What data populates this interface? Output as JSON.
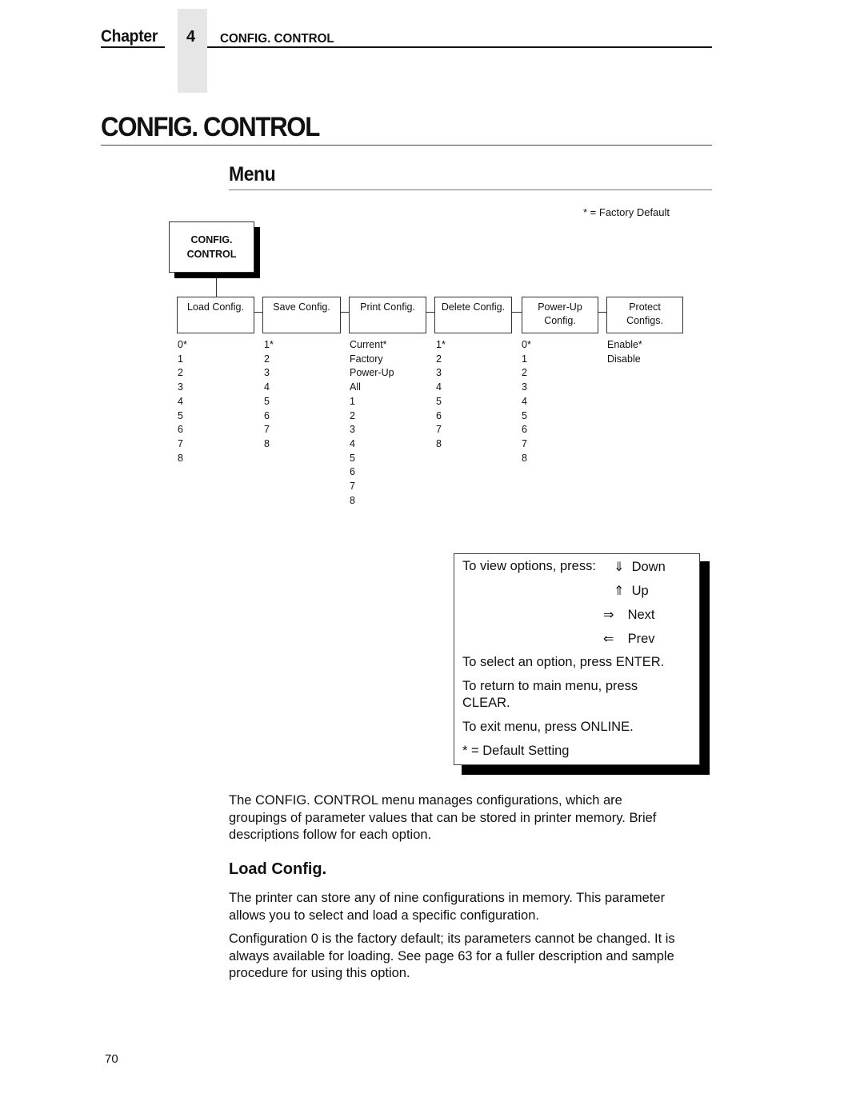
{
  "header": {
    "chapter_word": "Chapter",
    "chapter_number": "4",
    "chapter_title": "CONFIG. CONTROL"
  },
  "page_title": "CONFIG. CONTROL",
  "menu_section": {
    "heading": "Menu",
    "factory_default_note": "* = Factory Default"
  },
  "diagram": {
    "root": {
      "line1": "CONFIG.",
      "line2": "CONTROL"
    },
    "submenus": [
      {
        "label_line1": "Load Config.",
        "label_line2": "",
        "options": [
          "0*",
          "1",
          "2",
          "3",
          "4",
          "5",
          "6",
          "7",
          "8"
        ]
      },
      {
        "label_line1": "Save Config.",
        "label_line2": "",
        "options": [
          "1*",
          "2",
          "3",
          "4",
          "5",
          "6",
          "7",
          "8"
        ]
      },
      {
        "label_line1": "Print Config.",
        "label_line2": "",
        "options": [
          "Current*",
          "Factory",
          "Power-Up",
          "All",
          "1",
          "2",
          "3",
          "4",
          "5",
          "6",
          "7",
          "8"
        ]
      },
      {
        "label_line1": "Delete Config.",
        "label_line2": "",
        "options": [
          "1*",
          "2",
          "3",
          "4",
          "5",
          "6",
          "7",
          "8"
        ]
      },
      {
        "label_line1": "Power-Up",
        "label_line2": "Config.",
        "options": [
          "0*",
          "1",
          "2",
          "3",
          "4",
          "5",
          "6",
          "7",
          "8"
        ]
      },
      {
        "label_line1": "Protect",
        "label_line2": "Configs.",
        "options": [
          "Enable*",
          "Disable"
        ]
      }
    ]
  },
  "help_box": {
    "view_prefix": "To view options, press:",
    "nav": [
      {
        "icon": "double-arrow-down-icon",
        "glyph": "⇓",
        "label": "Down"
      },
      {
        "icon": "double-arrow-up-icon",
        "glyph": "⇑",
        "label": "Up"
      },
      {
        "icon": "double-arrow-right-icon",
        "glyph": "⇒",
        "label": "Next"
      },
      {
        "icon": "double-arrow-left-icon",
        "glyph": "⇐",
        "label": "Prev"
      }
    ],
    "select_line": "To select an option, press ENTER.",
    "return_line1": "To return to main menu, press",
    "return_line2": "CLEAR.",
    "exit_line": "To exit menu, press ONLINE.",
    "default_line": "* = Default Setting"
  },
  "body": {
    "intro_lines": [
      "The CONFIG. CONTROL menu manages configurations, which are",
      "groupings of parameter values that can be stored in printer memory. Brief",
      "descriptions follow for each option."
    ],
    "load_config_heading": "Load Config.",
    "p1_lines": [
      "The printer can store any of nine configurations in memory. This parameter",
      "allows you to select and load a specific configuration."
    ],
    "p2_lines": [
      "Configuration 0 is the factory default; its parameters cannot be changed. It is",
      "always available for loading. See page 63 for a fuller description and sample",
      "procedure for using this option."
    ]
  },
  "footer": {
    "page_number": "70"
  }
}
